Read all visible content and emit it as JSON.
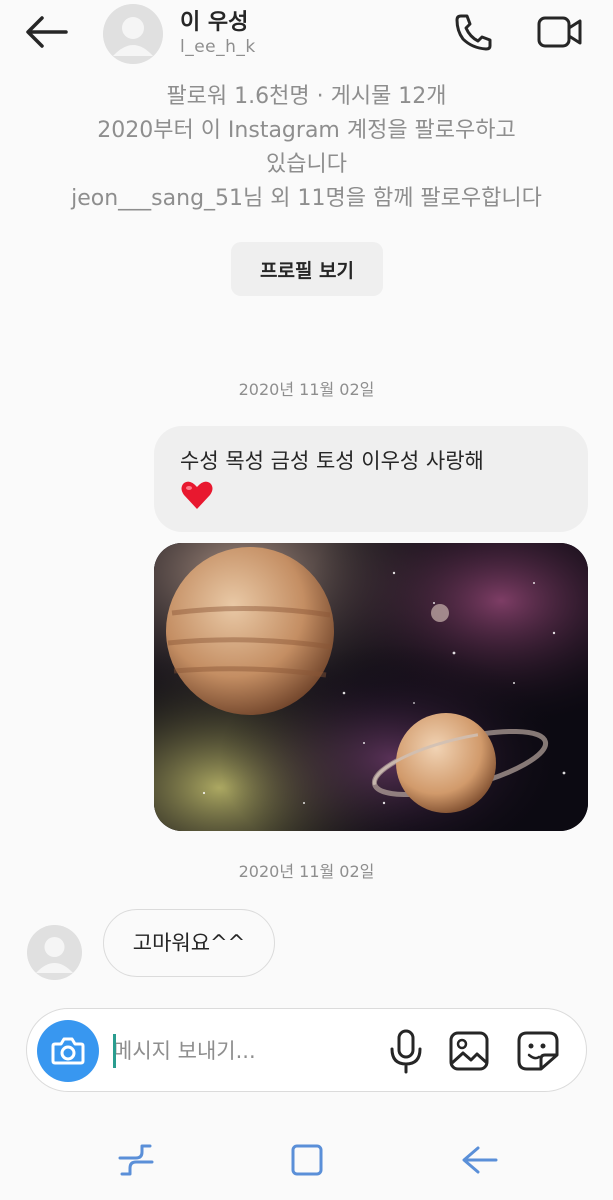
{
  "header": {
    "name": "이 우성",
    "username": "l_ee_h_k"
  },
  "profile_info": {
    "stats": "팔로워 1.6천명 · 게시물 12개",
    "since_line1": "2020부터 이 Instagram 계정을 팔로우하고",
    "since_line2": "있습니다",
    "mutuals": "jeon___sang_51님 외 11명을 함께 팔로우합니다",
    "view_profile_label": "프로필 보기"
  },
  "messages": {
    "timestamp_1": "2020년 11월 02일",
    "sent_text": "수성 목성 금성 토성 이우성 사랑해",
    "timestamp_2": "2020년 11월 02일",
    "received_text": "고마워요^^"
  },
  "composer": {
    "placeholder": "메시지 보내기..."
  },
  "icons": {
    "back": "arrow-left-icon",
    "call": "phone-icon",
    "video": "video-camera-icon",
    "heart": "red-heart-emoji",
    "camera": "camera-icon",
    "mic": "microphone-icon",
    "gallery": "image-icon",
    "sticker": "sticker-icon",
    "nav_recent": "recent-apps-icon",
    "nav_home": "home-icon",
    "nav_back": "nav-back-icon"
  },
  "colors": {
    "accent": "#3897f0",
    "bubble": "#efefef",
    "muted_text": "#8e8e8e",
    "heart": "#e8182f",
    "nav_icon": "#5a8fd8"
  }
}
